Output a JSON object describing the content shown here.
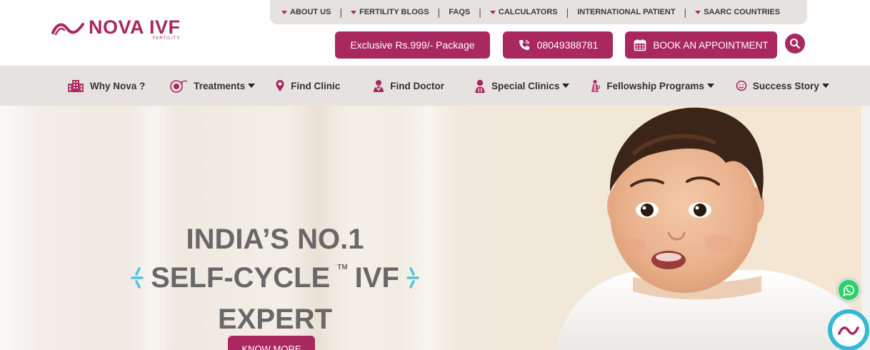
{
  "brand": {
    "name": "NOVA IVF",
    "tagline": "FERTILITY",
    "color": "#a8285f"
  },
  "topbar": [
    {
      "label": "ABOUT US",
      "caret": true
    },
    {
      "label": "FERTILITY BLOGS",
      "caret": true
    },
    {
      "label": "FAQS",
      "caret": false
    },
    {
      "label": "CALCULATORS",
      "caret": true
    },
    {
      "label": "INTERNATIONAL PATIENT",
      "caret": false
    },
    {
      "label": "SAARC COUNTRIES",
      "caret": true
    }
  ],
  "actions": {
    "package_label": "Exclusive Rs.999/- Package",
    "phone_label": "08049388781",
    "book_label": "BOOK AN APPOINTMENT",
    "search_icon": "search-icon"
  },
  "nav": [
    {
      "label": "Why Nova ?",
      "icon": "building-icon",
      "caret": false
    },
    {
      "label": "Treatments",
      "icon": "treatment-icon",
      "caret": true
    },
    {
      "label": "Find Clinic",
      "icon": "map-pin-icon",
      "caret": false
    },
    {
      "label": "Find Doctor",
      "icon": "doctor-icon",
      "caret": false
    },
    {
      "label": "Special Clinics",
      "icon": "special-clinic-icon",
      "caret": true
    },
    {
      "label": "Fellowship Programs",
      "icon": "fellowship-icon",
      "caret": true
    },
    {
      "label": "Success Story",
      "icon": "smile-icon",
      "caret": true
    }
  ],
  "hero": {
    "line1": "INDIA’S NO.1",
    "line2": "SELF-CYCLE",
    "tm": "TM",
    "line2b": "IVF",
    "line3": "EXPERT",
    "cta": "KNOW MORE"
  },
  "colors": {
    "accent": "#a8285f",
    "bar": "#e5e2e0",
    "headline": "#686868",
    "sparkle": "#4fc3dd",
    "chat": "#34b8d6",
    "whatsapp": "#25d366"
  }
}
